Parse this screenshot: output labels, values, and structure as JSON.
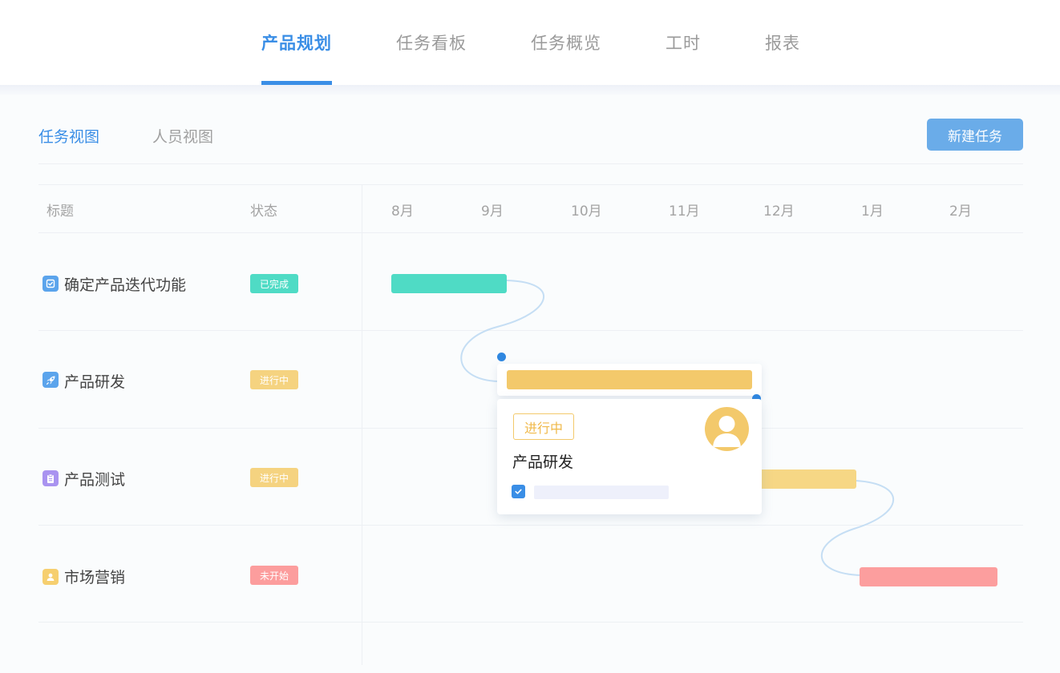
{
  "nav": {
    "tabs": [
      {
        "label": "产品规划",
        "active": true
      },
      {
        "label": "任务看板",
        "active": false
      },
      {
        "label": "任务概览",
        "active": false
      },
      {
        "label": "工时",
        "active": false
      },
      {
        "label": "报表",
        "active": false
      }
    ]
  },
  "view_tabs": [
    {
      "label": "任务视图",
      "active": true
    },
    {
      "label": "人员视图",
      "active": false
    }
  ],
  "toolbar": {
    "new_task_label": "新建任务"
  },
  "table": {
    "headers": {
      "title": "标题",
      "status": "状态"
    },
    "months": [
      "8月",
      "9月",
      "10月",
      "11月",
      "12月",
      "1月",
      "2月"
    ],
    "rows": [
      {
        "title": "确定产品迭代功能",
        "status": "已完成",
        "icon": "checklist-icon",
        "icon_color": "#5ba4ec",
        "status_color": "#4fdbc5",
        "bar_color": "#4fdbc5"
      },
      {
        "title": "产品研发",
        "status": "进行中",
        "icon": "rocket-icon",
        "icon_color": "#5ba4ec",
        "status_color": "#f5d380",
        "bar_color": "#f3c96b"
      },
      {
        "title": "产品测试",
        "status": "进行中",
        "icon": "clipboard-icon",
        "icon_color": "#a993f0",
        "status_color": "#f5d380",
        "bar_color": "#f6d785"
      },
      {
        "title": "市场营销",
        "status": "未开始",
        "icon": "user-icon",
        "icon_color": "#f6cf6f",
        "status_color": "#fc9d9d",
        "bar_color": "#fc9e9e"
      }
    ]
  },
  "popup": {
    "status": "进行中",
    "title": "产品研发",
    "avatar_icon": "avatar-icon",
    "checked": true
  },
  "colors": {
    "accent": "#3a8ee6",
    "completed": "#4fdbc5",
    "in_progress": "#f3c96b",
    "not_started": "#fc9e9e",
    "connector": "#c5def4"
  }
}
